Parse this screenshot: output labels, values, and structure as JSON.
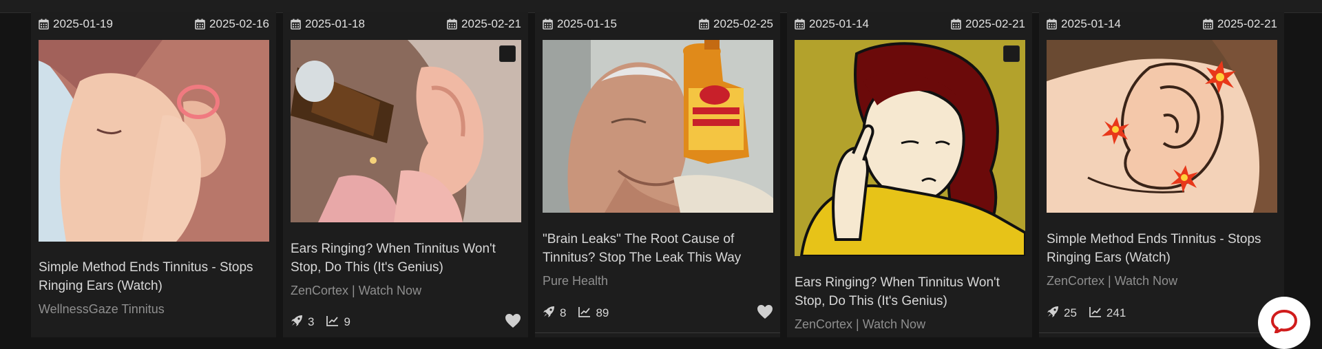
{
  "cards": [
    {
      "start_date": "2025-01-19",
      "end_date": "2025-02-16",
      "title": "Simple Method Ends Tinnitus - Stops Ringing Ears (Watch)",
      "source": "WellnessGaze Tinnitus",
      "image": "woman-holding-ear-illustration"
    },
    {
      "start_date": "2025-01-18",
      "end_date": "2025-02-21",
      "title": "Ears Ringing? When Tinnitus Won't Stop, Do This (It's Genius)",
      "source": "ZenCortex | Watch Now",
      "image": "ear-drops-photo",
      "rockets": "3",
      "views": "9"
    },
    {
      "start_date": "2025-01-15",
      "end_date": "2025-02-25",
      "title": "\"Brain Leaks\" The Root Cause of Tinnitus? Stop The Leak This Way",
      "source": "Pure Health",
      "image": "elderly-man-vinegar-photo",
      "rockets": "8",
      "views": "89"
    },
    {
      "start_date": "2025-01-14",
      "end_date": "2025-02-21",
      "title": "Ears Ringing? When Tinnitus Won't Stop, Do This (It's Genius)",
      "source": "ZenCortex | Watch Now",
      "image": "cartoon-woman-finger-in-ear"
    },
    {
      "start_date": "2025-01-14",
      "end_date": "2025-02-21",
      "title": "Simple Method Ends Tinnitus - Stops Ringing Ears (Watch)",
      "source": "ZenCortex | Watch Now",
      "image": "ear-pain-illustration",
      "rockets": "25",
      "views": "241"
    }
  ],
  "icons": {
    "date": "calendar-icon",
    "rockets": "rocket-icon",
    "views": "chart-line-icon",
    "like": "heart-icon",
    "chat": "chat-bubble-icon"
  },
  "colors": {
    "page_bg": "#141414",
    "card_bg": "#1d1d1d",
    "text": "#d8d8d8",
    "muted": "#8f8f8f",
    "chat_icon": "#d01c1c"
  }
}
